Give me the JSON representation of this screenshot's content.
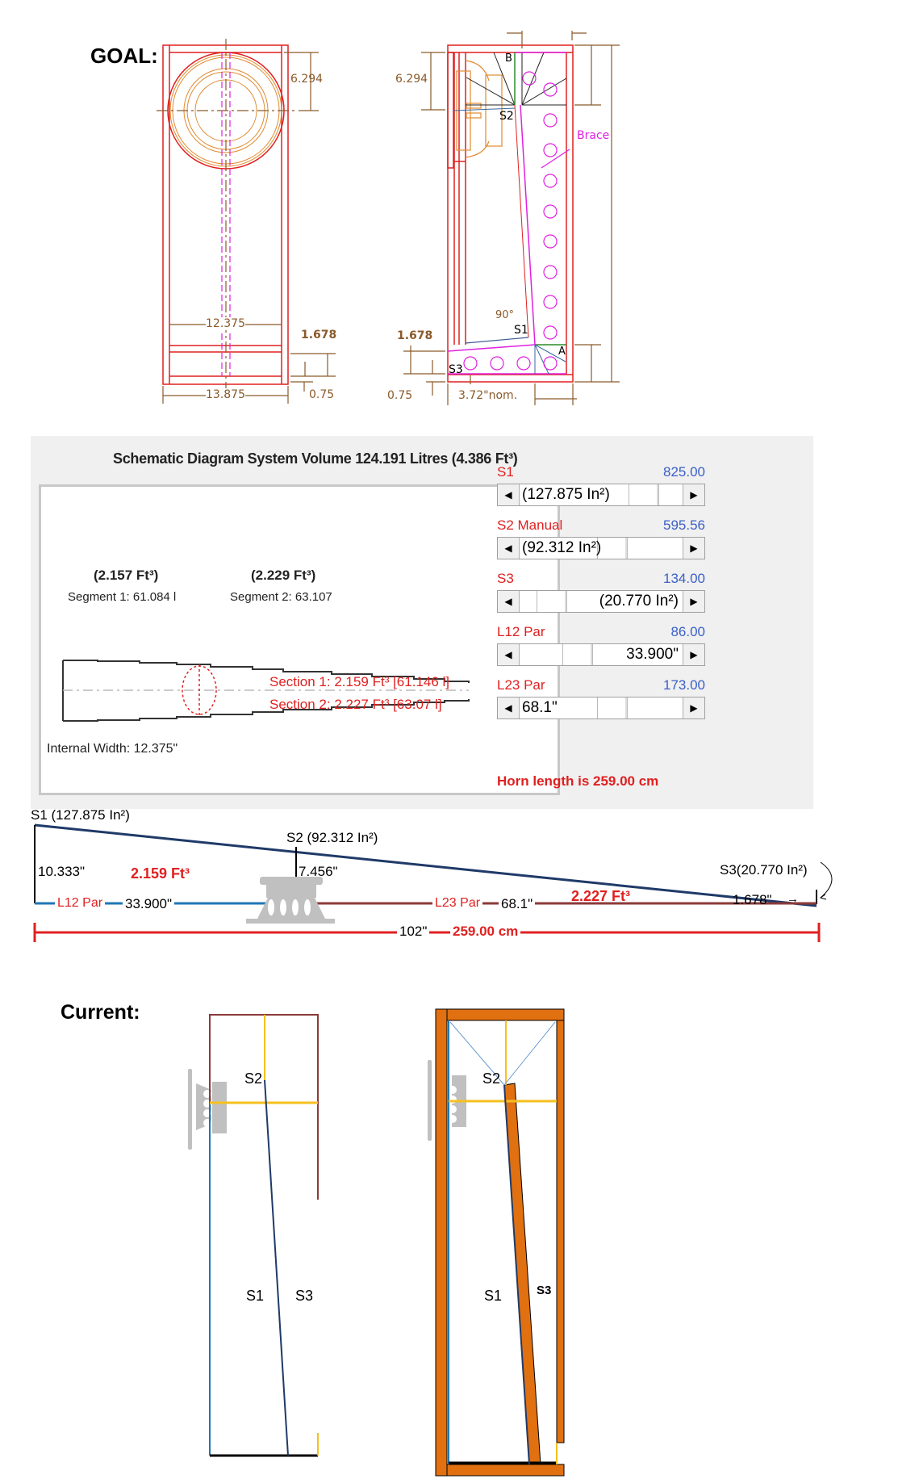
{
  "goal": {
    "heading": "GOAL:",
    "front_view": {
      "dim_driver_center": "6.294",
      "dim_internal_width": "12.375",
      "dim_external_width": "13.875",
      "dim_mouth_height": "1.678",
      "dim_panel_thickness": "0.75"
    },
    "side_view": {
      "dim_driver_center": "6.294",
      "dim_mouth_height": "1.678",
      "dim_panel_thickness": "0.75",
      "dim_nominal": "3.72\"nom.",
      "angle_label": "90°",
      "label_brace": "Brace",
      "label_s1": "S1",
      "label_s2": "S2",
      "label_s3": "S3",
      "label_a": "A",
      "label_b": "B"
    }
  },
  "schematic_panel": {
    "title": "Schematic Diagram   System Volume 124.191 Litres (4.386 Ft³)",
    "segment1_volume": "(2.157 Ft³)",
    "segment1_label": "Segment 1: 61.084 l",
    "segment2_volume": "(2.229 Ft³)",
    "segment2_label": "Segment 2:  63.107",
    "section1": "Section 1:  2.159 Ft³ [61.146 l]",
    "section2": "Section 2:  2.227 Ft³ [63.07 l]",
    "internal_width": "Internal Width: 12.375\"",
    "controls": [
      {
        "label": "S1",
        "value": "825.00",
        "display": "(127.875 In²)",
        "position": 0.8
      },
      {
        "label": "S2  Manual",
        "value": "595.56",
        "display": "(92.312 In²)",
        "position": 0.57
      },
      {
        "label": "S3",
        "value": "134.00",
        "display": "(20.770 In²)",
        "position": 0.13
      },
      {
        "label": "L12  Par",
        "value": "86.00",
        "display": "33.900\"",
        "position": 0.32
      },
      {
        "label": "L23  Par",
        "value": "173.00",
        "display": "68.1\"",
        "position": 0.57
      }
    ],
    "horn_length": "Horn length is 259.00 cm"
  },
  "line_diagram": {
    "s1_label": "S1 (127.875 In²)",
    "s2_label": "S2 (92.312 In²)",
    "s3_label": "S3(20.770 In²)",
    "s1_height": "10.333\"",
    "s2_height": "7.456\"",
    "s3_height": "1.678\"",
    "vol1": "2.159 Ft³",
    "vol2": "2.227 Ft³",
    "l12_label": "L12 Par",
    "l12_value": "33.900\"",
    "l23_label": "L23 Par",
    "l23_value": "68.1\"",
    "total_inches": "102\"",
    "total_cm": "259.00 cm",
    "colors": {
      "taper": "#1f3a68",
      "l12": "#1f77b4",
      "l23": "#8b3a3a",
      "total": "#e02020"
    }
  },
  "current": {
    "heading": "Current:",
    "left_s1": "S1",
    "left_s2": "S2",
    "left_s3": "S3",
    "right_s1": "S1",
    "right_s2": "S2",
    "right_s3": "S3",
    "colors": {
      "panel": "#e07010",
      "divider": "#f5c020"
    }
  }
}
